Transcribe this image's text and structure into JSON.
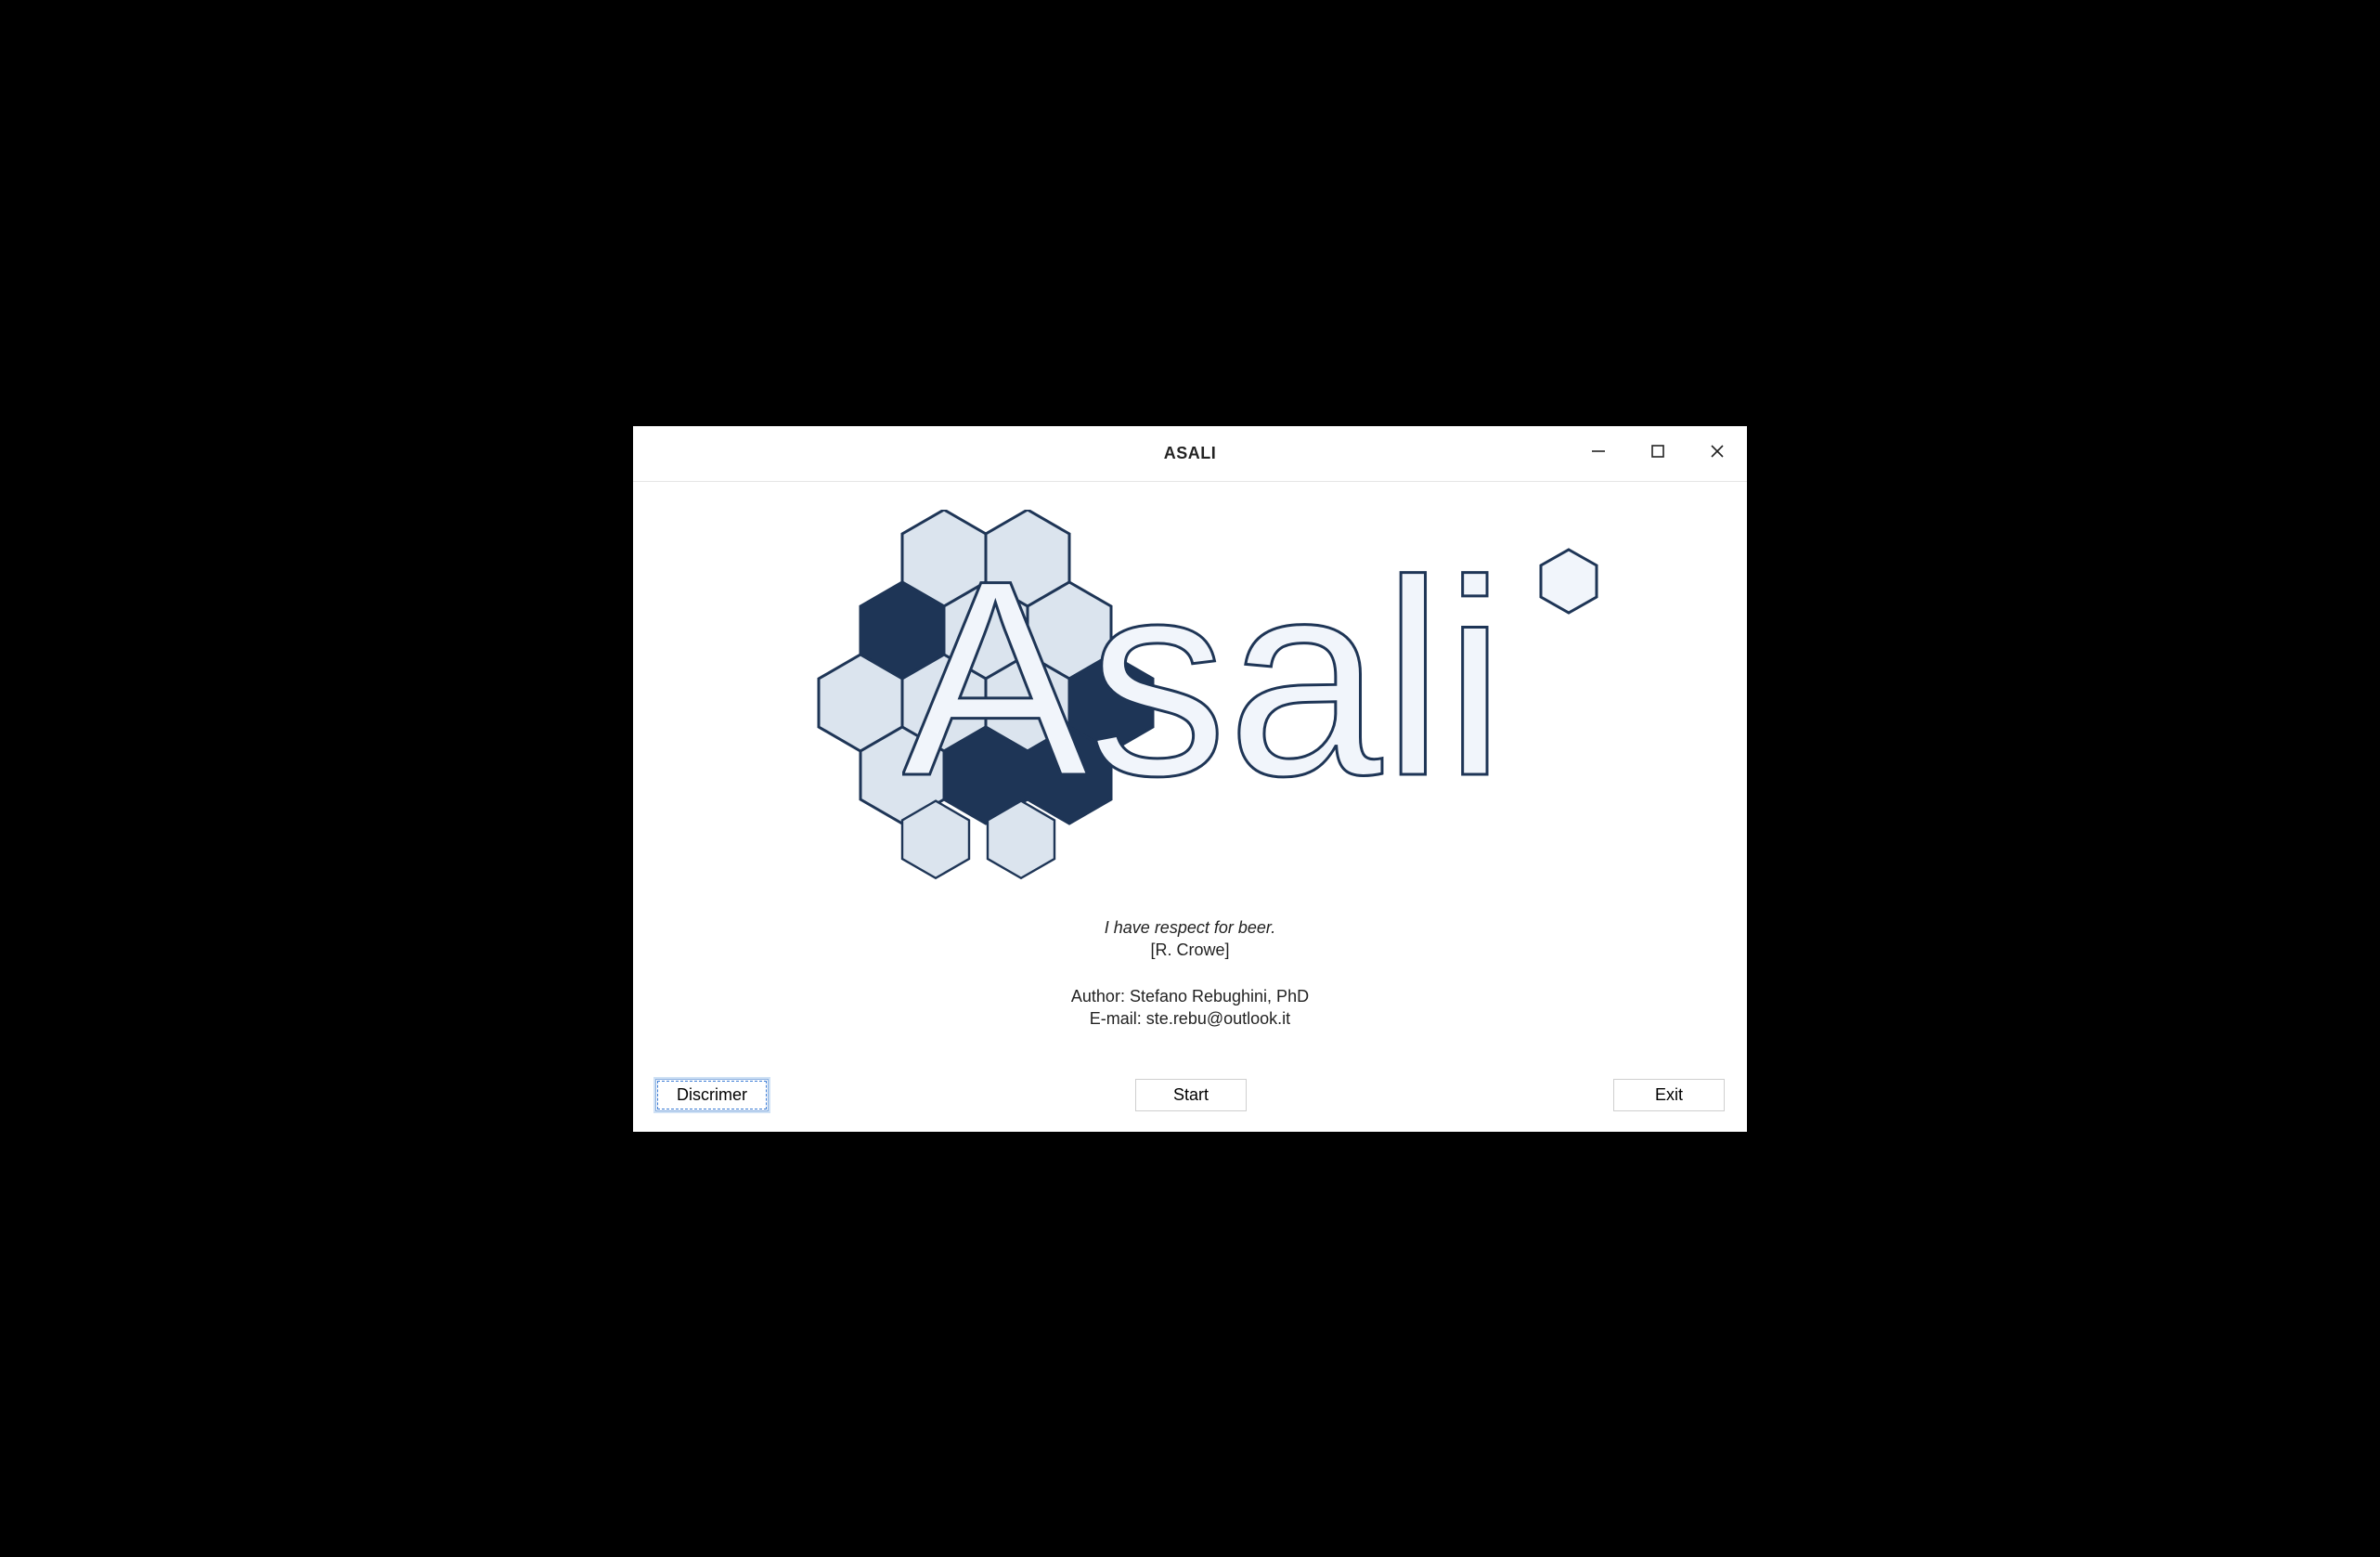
{
  "window": {
    "title": "ASALI"
  },
  "logo": {
    "wordmark": "Asali",
    "hex_colors": {
      "light": "#dbe4ee",
      "dark": "#1e3556",
      "stroke": "#1e3556"
    },
    "text_fill": "#f1f5fb",
    "text_stroke": "#1e3556"
  },
  "quote": {
    "line": "I have respect for beer.",
    "attribution": "[R. Crowe]"
  },
  "credits": {
    "author": "Author: Stefano Rebughini, PhD",
    "email": "E-mail: ste.rebu@outlook.it"
  },
  "buttons": {
    "disclaimer": "Discrimer",
    "start": "Start",
    "exit": "Exit"
  }
}
